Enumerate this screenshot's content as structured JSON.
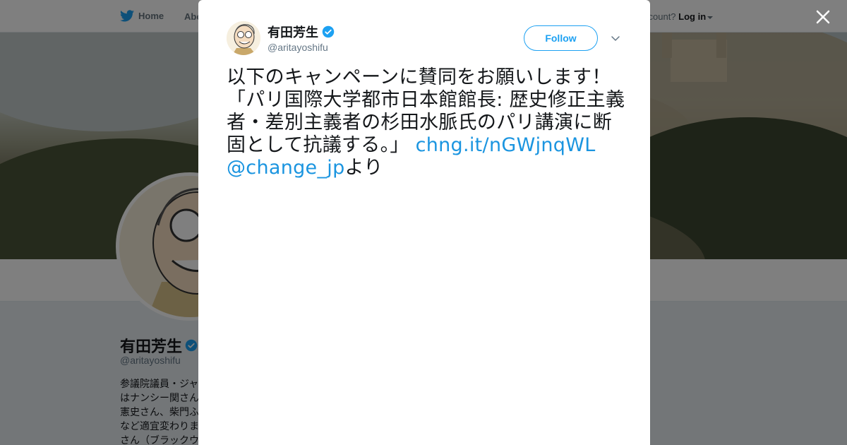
{
  "topnav": {
    "home_label": "Home",
    "about_label": "Abo",
    "account_prompt": "ccount?",
    "login_label": "Log in"
  },
  "profile": {
    "name": "有田芳生",
    "handle": "@aritayoshifu",
    "bio": "参議院議員・ジャはナンシー関さん憲史さん、柴門ふなど適宜変わりまさん（ブラックウ"
  },
  "modal": {
    "name": "有田芳生",
    "handle": "@aritayoshifu",
    "follow_label": "Follow",
    "tweet": {
      "text": "以下のキャンペーンに賛同をお願いします！「パリ国際大学都市日本館館長: 歴史修正主義者・差別主義者の杉田水脈氏のパリ講演に断固として抗議する。」 ",
      "link": "chng.it/nGWjnqWL",
      "mention": "@change_jp",
      "suffix": "より"
    }
  },
  "colors": {
    "accent": "#1da1f2",
    "link": "#1b95e0",
    "verified": "#1da1f2",
    "text": "#14171a",
    "muted": "#657786"
  },
  "icons": [
    "twitter-bird-icon",
    "verified-badge-icon",
    "chevron-down-icon",
    "close-icon",
    "caret-down-icon"
  ]
}
